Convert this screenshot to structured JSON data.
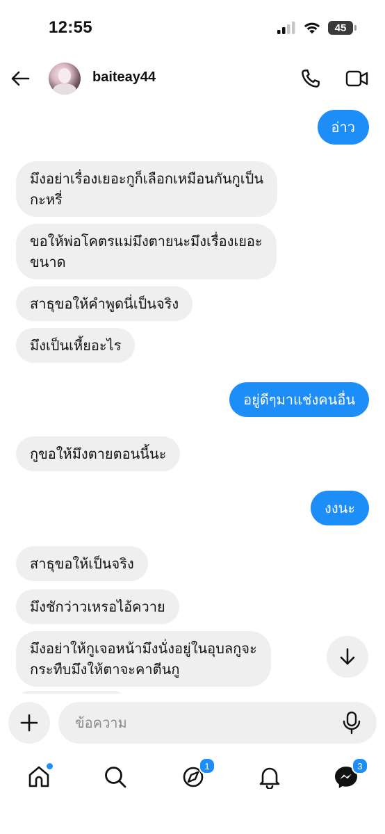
{
  "status_bar": {
    "time": "12:55",
    "battery": "45"
  },
  "header": {
    "username": "baiteay44",
    "back_icon": "arrow-left-icon",
    "call_icon": "phone-icon",
    "video_icon": "video-camera-icon"
  },
  "messages": [
    {
      "from": "me",
      "text": "อ่าว"
    },
    {
      "from": "them",
      "lines": [
        "มึงอย่าเรื่องเยอะกูก็เลือกเหมือนกันกูเป็น",
        "กะหรี่"
      ]
    },
    {
      "from": "them",
      "lines": [
        "ขอให้พ่อโคตรแม่มึงตายนะมึงเรื่องเยอะ",
        "ขนาด"
      ]
    },
    {
      "from": "them",
      "text": "สาธุขอให้คำพูดนี่เป็นจริง"
    },
    {
      "from": "them",
      "text": "มึงเป็นเหี้ยอะไร"
    },
    {
      "from": "me",
      "text": "อยู่ดีๆมาแช่งคนอื่น"
    },
    {
      "from": "them",
      "text": "กูขอให้มึงตายตอนนี้นะ"
    },
    {
      "from": "me",
      "text": "งงนะ"
    },
    {
      "from": "them",
      "text": "สาธุขอให้เป็นจริง"
    },
    {
      "from": "them",
      "text": "มึงชักว่าวเหรอไอ้ควาย"
    },
    {
      "from": "them",
      "lines": [
        "มึงอย่าให้กูเจอหน้ามึงนั่งอยู่ในอุบลกูจะ",
        "กระทืบมึงให้ตาจะคาตีนกู"
      ]
    }
  ],
  "composer": {
    "placeholder": "ข้อความ",
    "value": ""
  },
  "nav": {
    "items": [
      {
        "icon": "home-icon",
        "dot": true
      },
      {
        "icon": "search-icon"
      },
      {
        "icon": "threads-icon",
        "badge": "1"
      },
      {
        "icon": "bell-icon"
      },
      {
        "icon": "messenger-icon",
        "badge": "3"
      }
    ]
  },
  "colors": {
    "accent": "#1d8df7",
    "incoming_bubble": "#efefef"
  }
}
